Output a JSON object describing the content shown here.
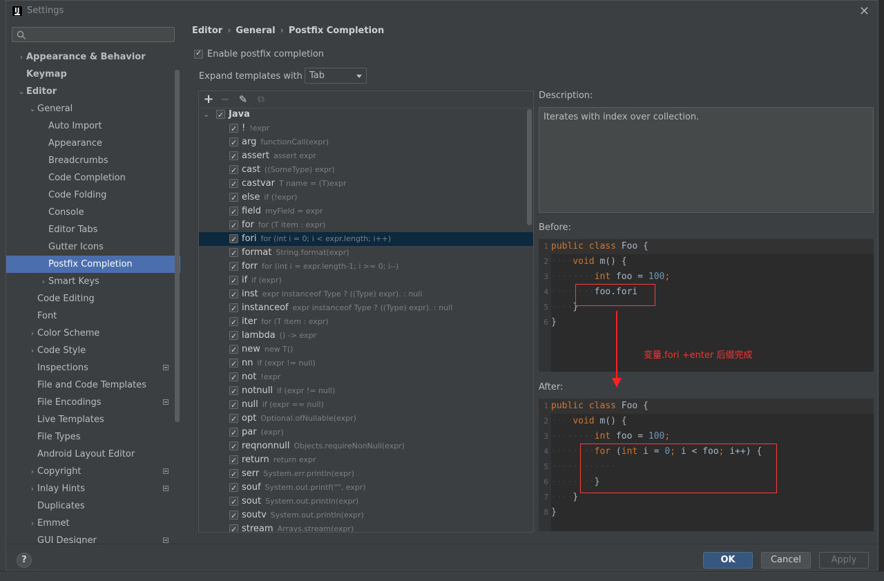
{
  "window": {
    "title": "Settings",
    "app_icon_text": "IJ"
  },
  "search": {
    "placeholder": "",
    "value": ""
  },
  "sidebar": {
    "items": [
      {
        "label": "Appearance & Behavior",
        "level": 0,
        "bold": true,
        "arrow": "›",
        "badge": false,
        "selected": false
      },
      {
        "label": "Keymap",
        "level": 0,
        "bold": true,
        "arrow": "",
        "badge": false,
        "selected": false
      },
      {
        "label": "Editor",
        "level": 0,
        "bold": true,
        "arrow": "⌄",
        "badge": false,
        "selected": false
      },
      {
        "label": "General",
        "level": 1,
        "bold": false,
        "arrow": "⌄",
        "badge": false,
        "selected": false
      },
      {
        "label": "Auto Import",
        "level": 2,
        "bold": false,
        "arrow": "",
        "badge": false,
        "selected": false
      },
      {
        "label": "Appearance",
        "level": 2,
        "bold": false,
        "arrow": "",
        "badge": false,
        "selected": false
      },
      {
        "label": "Breadcrumbs",
        "level": 2,
        "bold": false,
        "arrow": "",
        "badge": false,
        "selected": false
      },
      {
        "label": "Code Completion",
        "level": 2,
        "bold": false,
        "arrow": "",
        "badge": false,
        "selected": false
      },
      {
        "label": "Code Folding",
        "level": 2,
        "bold": false,
        "arrow": "",
        "badge": false,
        "selected": false
      },
      {
        "label": "Console",
        "level": 2,
        "bold": false,
        "arrow": "",
        "badge": false,
        "selected": false
      },
      {
        "label": "Editor Tabs",
        "level": 2,
        "bold": false,
        "arrow": "",
        "badge": false,
        "selected": false
      },
      {
        "label": "Gutter Icons",
        "level": 2,
        "bold": false,
        "arrow": "",
        "badge": false,
        "selected": false
      },
      {
        "label": "Postfix Completion",
        "level": 2,
        "bold": false,
        "arrow": "",
        "badge": false,
        "selected": true
      },
      {
        "label": "Smart Keys",
        "level": 2,
        "bold": false,
        "arrow": "›",
        "badge": false,
        "selected": false
      },
      {
        "label": "Code Editing",
        "level": 1,
        "bold": false,
        "arrow": "",
        "badge": false,
        "selected": false
      },
      {
        "label": "Font",
        "level": 1,
        "bold": false,
        "arrow": "",
        "badge": false,
        "selected": false
      },
      {
        "label": "Color Scheme",
        "level": 1,
        "bold": false,
        "arrow": "›",
        "badge": false,
        "selected": false
      },
      {
        "label": "Code Style",
        "level": 1,
        "bold": false,
        "arrow": "›",
        "badge": false,
        "selected": false
      },
      {
        "label": "Inspections",
        "level": 1,
        "bold": false,
        "arrow": "",
        "badge": true,
        "selected": false
      },
      {
        "label": "File and Code Templates",
        "level": 1,
        "bold": false,
        "arrow": "",
        "badge": false,
        "selected": false
      },
      {
        "label": "File Encodings",
        "level": 1,
        "bold": false,
        "arrow": "",
        "badge": true,
        "selected": false
      },
      {
        "label": "Live Templates",
        "level": 1,
        "bold": false,
        "arrow": "",
        "badge": false,
        "selected": false
      },
      {
        "label": "File Types",
        "level": 1,
        "bold": false,
        "arrow": "",
        "badge": false,
        "selected": false
      },
      {
        "label": "Android Layout Editor",
        "level": 1,
        "bold": false,
        "arrow": "",
        "badge": false,
        "selected": false
      },
      {
        "label": "Copyright",
        "level": 1,
        "bold": false,
        "arrow": "›",
        "badge": true,
        "selected": false
      },
      {
        "label": "Inlay Hints",
        "level": 1,
        "bold": false,
        "arrow": "›",
        "badge": true,
        "selected": false
      },
      {
        "label": "Duplicates",
        "level": 1,
        "bold": false,
        "arrow": "",
        "badge": false,
        "selected": false
      },
      {
        "label": "Emmet",
        "level": 1,
        "bold": false,
        "arrow": "›",
        "badge": false,
        "selected": false
      },
      {
        "label": "GUI Designer",
        "level": 1,
        "bold": false,
        "arrow": "",
        "badge": true,
        "selected": false
      }
    ]
  },
  "breadcrumb": {
    "items": [
      "Editor",
      "General",
      "Postfix Completion"
    ],
    "separator": "›"
  },
  "enable": {
    "label": "Enable postfix completion",
    "checked": true
  },
  "expand": {
    "label": "Expand templates with",
    "value": "Tab"
  },
  "toolbar": {
    "add_icon": "+",
    "remove_icon": "−",
    "edit_icon": "✎",
    "copy_icon": "⧉"
  },
  "templates": {
    "group": "Java",
    "items": [
      {
        "key": "!",
        "example": "!expr"
      },
      {
        "key": "arg",
        "example": "functionCall(expr)"
      },
      {
        "key": "assert",
        "example": "assert expr"
      },
      {
        "key": "cast",
        "example": "((SomeType) expr)"
      },
      {
        "key": "castvar",
        "example": "T name = (T)expr"
      },
      {
        "key": "else",
        "example": "if (!expr)"
      },
      {
        "key": "field",
        "example": "myField = expr"
      },
      {
        "key": "for",
        "example": "for (T item : expr)"
      },
      {
        "key": "fori",
        "example": "for (int i = 0; i < expr.length; i++)",
        "selected": true
      },
      {
        "key": "format",
        "example": "String.format(expr)"
      },
      {
        "key": "forr",
        "example": "for (int i = expr.length-1; i >= 0; i--)"
      },
      {
        "key": "if",
        "example": "if (expr)"
      },
      {
        "key": "inst",
        "example": "expr instanceof Type ? ((Type) expr). : null"
      },
      {
        "key": "instanceof",
        "example": "expr instanceof Type ? ((Type) expr). : null"
      },
      {
        "key": "iter",
        "example": "for (T item : expr)"
      },
      {
        "key": "lambda",
        "example": "() -> expr"
      },
      {
        "key": "new",
        "example": "new T()"
      },
      {
        "key": "nn",
        "example": "if (expr != null)"
      },
      {
        "key": "not",
        "example": "!expr"
      },
      {
        "key": "notnull",
        "example": "if (expr != null)"
      },
      {
        "key": "null",
        "example": "if (expr == null)"
      },
      {
        "key": "opt",
        "example": "Optional.ofNullable(expr)"
      },
      {
        "key": "par",
        "example": "(expr)"
      },
      {
        "key": "reqnonnull",
        "example": "Objects.requireNonNull(expr)"
      },
      {
        "key": "return",
        "example": "return expr"
      },
      {
        "key": "serr",
        "example": "System.err.println(expr)"
      },
      {
        "key": "souf",
        "example": "System.out.printf(\"\", expr)"
      },
      {
        "key": "sout",
        "example": "System.out.println(expr)"
      },
      {
        "key": "soutv",
        "example": "System.out.println(expr)"
      },
      {
        "key": "stream",
        "example": "Arrays.stream(expr)"
      }
    ]
  },
  "description": {
    "label": "Description:",
    "text": "Iterates with index over collection."
  },
  "before": {
    "label": "Before:",
    "lines": [
      {
        "n": "1",
        "html": "<span class='kw'>public class</span> Foo {"
      },
      {
        "n": "2",
        "html": "<span class='dots'>····</span><span class='kw'>void</span> m() {"
      },
      {
        "n": "3",
        "html": "<span class='dots'>········</span><span class='kw'>int</span> foo = <span class='num'>100</span><span class='kw'>;</span>"
      },
      {
        "n": "4",
        "html": "<span class='dots'>········</span>foo.fori"
      },
      {
        "n": "5",
        "html": "<span class='dots'>····</span>}"
      },
      {
        "n": "6",
        "html": "}"
      }
    ]
  },
  "after": {
    "label": "After:",
    "lines": [
      {
        "n": "1",
        "html": "<span class='kw'>public class</span> Foo {"
      },
      {
        "n": "2",
        "html": "<span class='dots'>····</span><span class='kw'>void</span> m() {"
      },
      {
        "n": "3",
        "html": "<span class='dots'>········</span><span class='kw'>int</span> foo = <span class='num'>100</span><span class='kw'>;</span>"
      },
      {
        "n": "4",
        "html": "<span class='dots'>········</span><span class='kw'>for</span> (<span class='kw'>int</span> i = <span class='num'>0</span><span class='kw'>;</span> i &lt; foo<span class='kw'>;</span> i++) {"
      },
      {
        "n": "5",
        "html": "<span class='dots'>············</span>"
      },
      {
        "n": "6",
        "html": "<span class='dots'>········</span>}"
      },
      {
        "n": "7",
        "html": "<span class='dots'>····</span>}"
      },
      {
        "n": "8",
        "html": "}"
      }
    ]
  },
  "annotation": {
    "text": "变量.fori   +enter  后缀完成",
    "color": "#ff3030"
  },
  "footer": {
    "help": "?",
    "ok": "OK",
    "cancel": "Cancel",
    "apply": "Apply"
  }
}
